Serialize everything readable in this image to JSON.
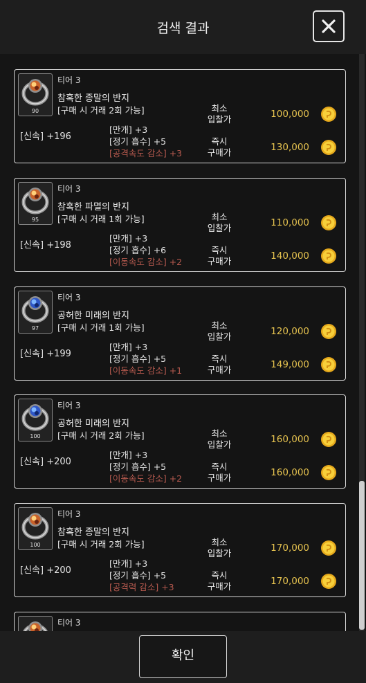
{
  "header": {
    "title": "검색 결과",
    "close_icon": "close-icon"
  },
  "footer": {
    "confirm_label": "확인"
  },
  "labels": {
    "min_bid": [
      "최소",
      "입찰가"
    ],
    "buy_now": [
      "즉시",
      "구매가"
    ]
  },
  "colors": {
    "price": "#e5c24f",
    "penalty": "#b5594e",
    "border": "#d8d8d8"
  },
  "items": [
    {
      "level": "90",
      "tier": "티어 3",
      "name": "참혹한 종말의 반지",
      "trade": "[구매 시 거래 2회 가능]",
      "stat": "[신속] +196",
      "e1": "[만개] +3",
      "e2": "[정기 흡수] +5",
      "e3": "[공격속도 감소] +3",
      "min_bid": "100,000",
      "buy_now": "130,000",
      "gem": "orange"
    },
    {
      "level": "95",
      "tier": "티어 3",
      "name": "참혹한 파멸의 반지",
      "trade": "[구매 시 거래 1회 가능]",
      "stat": "[신속] +198",
      "e1": "[만개] +3",
      "e2": "[정기 흡수] +6",
      "e3": "[이동속도 감소] +2",
      "min_bid": "110,000",
      "buy_now": "140,000",
      "gem": "orange"
    },
    {
      "level": "97",
      "tier": "티어 3",
      "name": "공허한 미래의 반지",
      "trade": "[구매 시 거래 1회 가능]",
      "stat": "[신속] +199",
      "e1": "[만개] +3",
      "e2": "[정기 흡수] +5",
      "e3": "[이동속도 감소] +1",
      "min_bid": "120,000",
      "buy_now": "149,000",
      "gem": "blue"
    },
    {
      "level": "100",
      "tier": "티어 3",
      "name": "공허한 미래의 반지",
      "trade": "[구매 시 거래 2회 가능]",
      "stat": "[신속] +200",
      "e1": "[만개] +3",
      "e2": "[정기 흡수] +5",
      "e3": "[이동속도 감소] +2",
      "min_bid": "160,000",
      "buy_now": "160,000",
      "gem": "blue"
    },
    {
      "level": "100",
      "tier": "티어 3",
      "name": "참혹한 종말의 반지",
      "trade": "[구매 시 거래 2회 가능]",
      "stat": "[신속] +200",
      "e1": "[만개] +3",
      "e2": "[정기 흡수] +5",
      "e3": "[공격력 감소] +3",
      "min_bid": "170,000",
      "buy_now": "170,000",
      "gem": "orange"
    },
    {
      "level": "",
      "tier": "티어 3",
      "gem": "orange"
    }
  ]
}
